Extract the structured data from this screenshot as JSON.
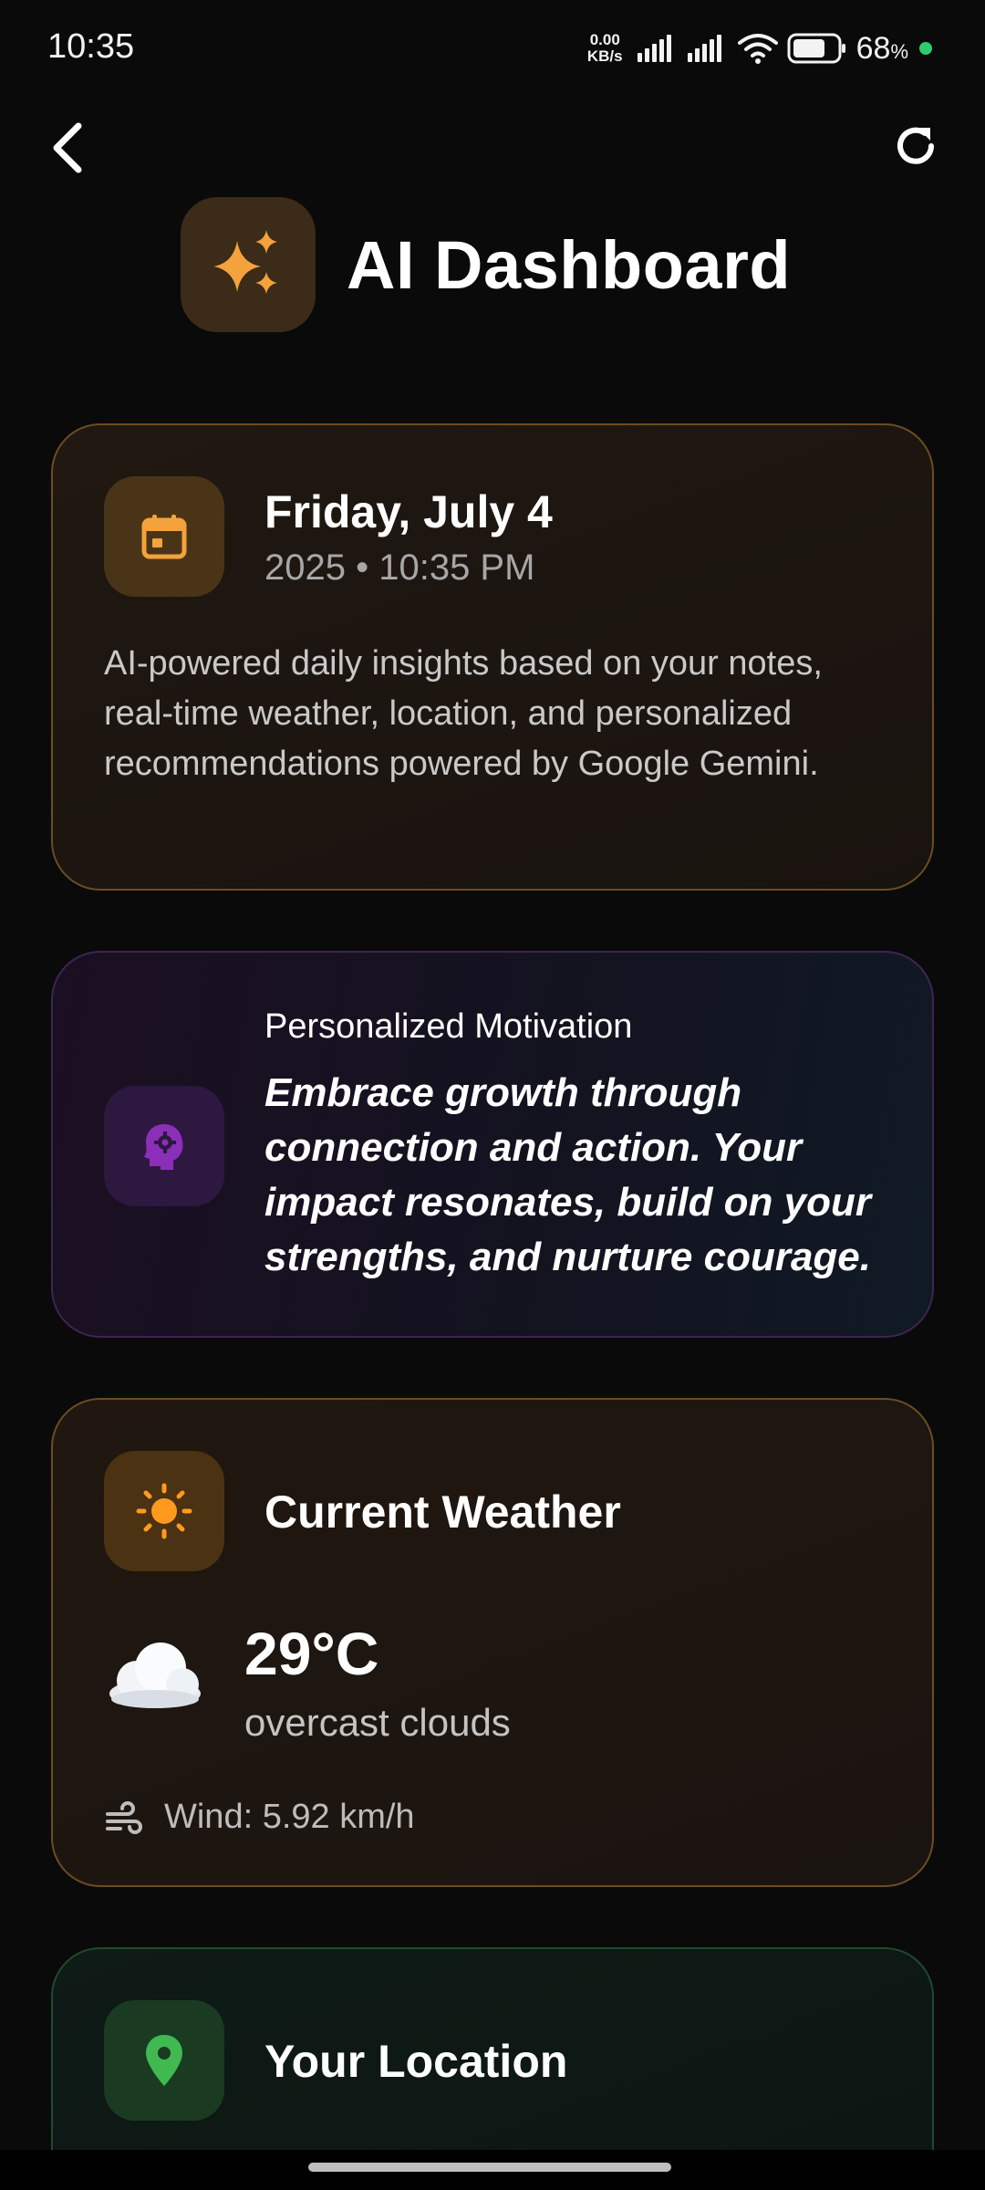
{
  "status_bar": {
    "time": "10:35",
    "net_speed_value": "0.00",
    "net_speed_unit": "KB/s",
    "battery_pct": "68",
    "battery_pct_symbol": "%"
  },
  "header": {
    "title": "AI Dashboard",
    "back_icon": "chevron-left-icon",
    "refresh_icon": "refresh-icon"
  },
  "date_card": {
    "title": "Friday, July 4",
    "subtitle": "2025  •  10:35 PM",
    "description": "AI-powered daily insights based on your notes, real-time weather, location, and personalized recommendations powered by Google Gemini.",
    "icon": "calendar-icon"
  },
  "motivation_card": {
    "label": "Personalized Motivation",
    "text": "Embrace growth through connection and action. Your impact resonates, build on your strengths, and nurture courage.",
    "icon": "brain-gear-icon"
  },
  "weather_card": {
    "title": "Current Weather",
    "temperature": "29°C",
    "condition": "overcast clouds",
    "wind": "Wind: 5.92 km/h",
    "icon": "sun-icon"
  },
  "location_card": {
    "title": "Your Location",
    "icon": "location-pin-icon"
  },
  "colors": {
    "accent_orange": "#f4a23c",
    "accent_purple": "#8b2fb8",
    "accent_green": "#3fb950",
    "background": "#0a0a0a"
  }
}
